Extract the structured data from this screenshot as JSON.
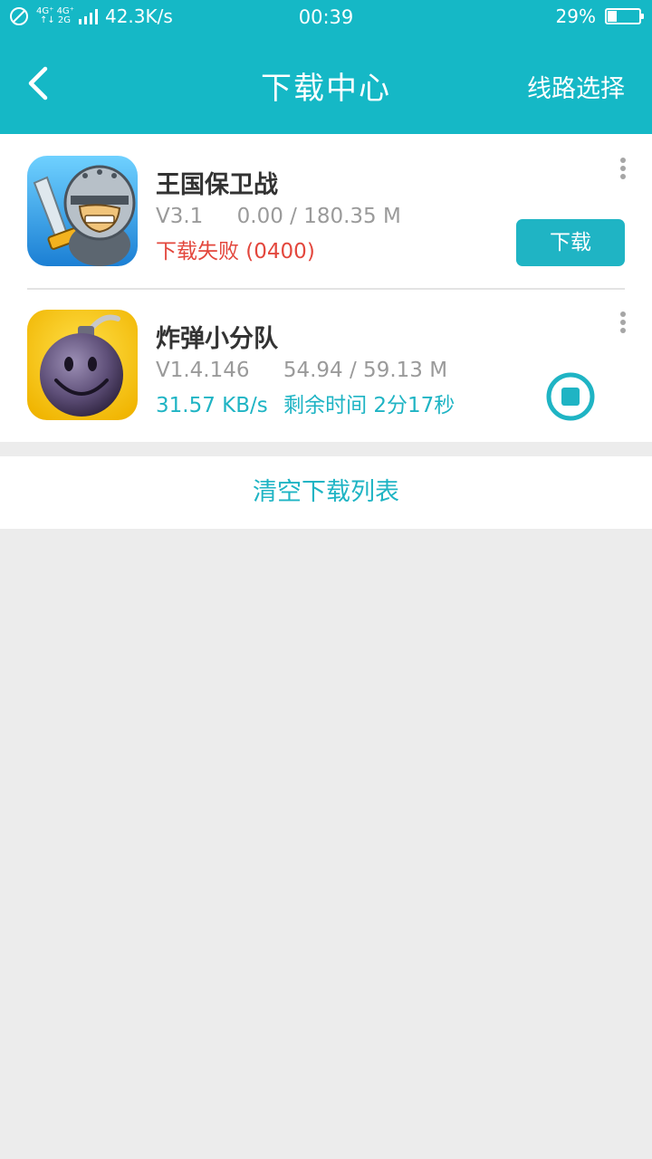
{
  "status_bar": {
    "signal_top": "4G⁺ 4G⁺",
    "signal_bottom": "↑↓ 2G",
    "net_speed": "42.3K/s",
    "time": "00:39",
    "battery": "29%",
    "battery_level": 0.29
  },
  "nav": {
    "title": "下载中心",
    "route_label": "线路选择",
    "back_icon": "chevron-left-icon"
  },
  "downloads": [
    {
      "name": "王国保卫战",
      "version": "V3.1",
      "size": "0.00 / 180.35 M",
      "status": "下载失败 (0400)",
      "action_label": "下载",
      "icon": "knight-game-icon"
    },
    {
      "name": "炸弹小分队",
      "version": "V1.4.146",
      "size": "54.94 / 59.13 M",
      "speed": "31.57 KB/s",
      "remaining": "剩余时间 2分17秒",
      "progress": 0.93,
      "icon": "bomb-game-icon"
    }
  ],
  "clear_label": "清空下载列表",
  "colors": {
    "accent": "#15b8c6",
    "error": "#e3473d",
    "text_gray": "#9a9a9a",
    "background": "#ececec"
  }
}
